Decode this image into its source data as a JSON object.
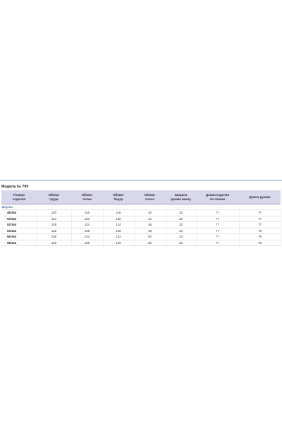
{
  "model_title": "Модель № 799",
  "headers": {
    "size": [
      "Размер",
      "изделия"
    ],
    "chest": [
      "Обхват",
      "груди"
    ],
    "waist": [
      "Обхват",
      "талии"
    ],
    "hips": [
      "Обхват",
      "бедер"
    ],
    "shoulder": [
      "Обхват",
      "плеча"
    ],
    "sleeve_width": [
      "Ширина",
      "рукава внизу"
    ],
    "back_length": [
      "Длина изделия",
      "по спинке"
    ],
    "sleeve_length": [
      "Длина рукава"
    ]
  },
  "group_label": "Блузы",
  "rows": [
    {
      "size": "48/164",
      "chest": "120",
      "waist": "116",
      "hips": "116",
      "shoulder": "42",
      "sleeve_width": "22",
      "back_length": "77",
      "sleeve_length": "77"
    },
    {
      "size": "50/164",
      "chest": "124",
      "waist": "120",
      "hips": "120",
      "shoulder": "44",
      "sleeve_width": "22",
      "back_length": "77",
      "sleeve_length": "77"
    },
    {
      "size": "52/164",
      "chest": "128",
      "waist": "124",
      "hips": "124",
      "shoulder": "46",
      "sleeve_width": "22",
      "back_length": "77",
      "sleeve_length": "77"
    },
    {
      "size": "54/164",
      "chest": "132",
      "waist": "128",
      "hips": "128",
      "shoulder": "48",
      "sleeve_width": "23",
      "back_length": "77",
      "sleeve_length": "78"
    },
    {
      "size": "56/164",
      "chest": "136",
      "waist": "132",
      "hips": "132",
      "shoulder": "50",
      "sleeve_width": "23",
      "back_length": "77",
      "sleeve_length": "78"
    },
    {
      "size": "58/164",
      "chest": "140",
      "waist": "136",
      "hips": "136",
      "shoulder": "52",
      "sleeve_width": "23",
      "back_length": "77",
      "sleeve_length": "78"
    }
  ]
}
